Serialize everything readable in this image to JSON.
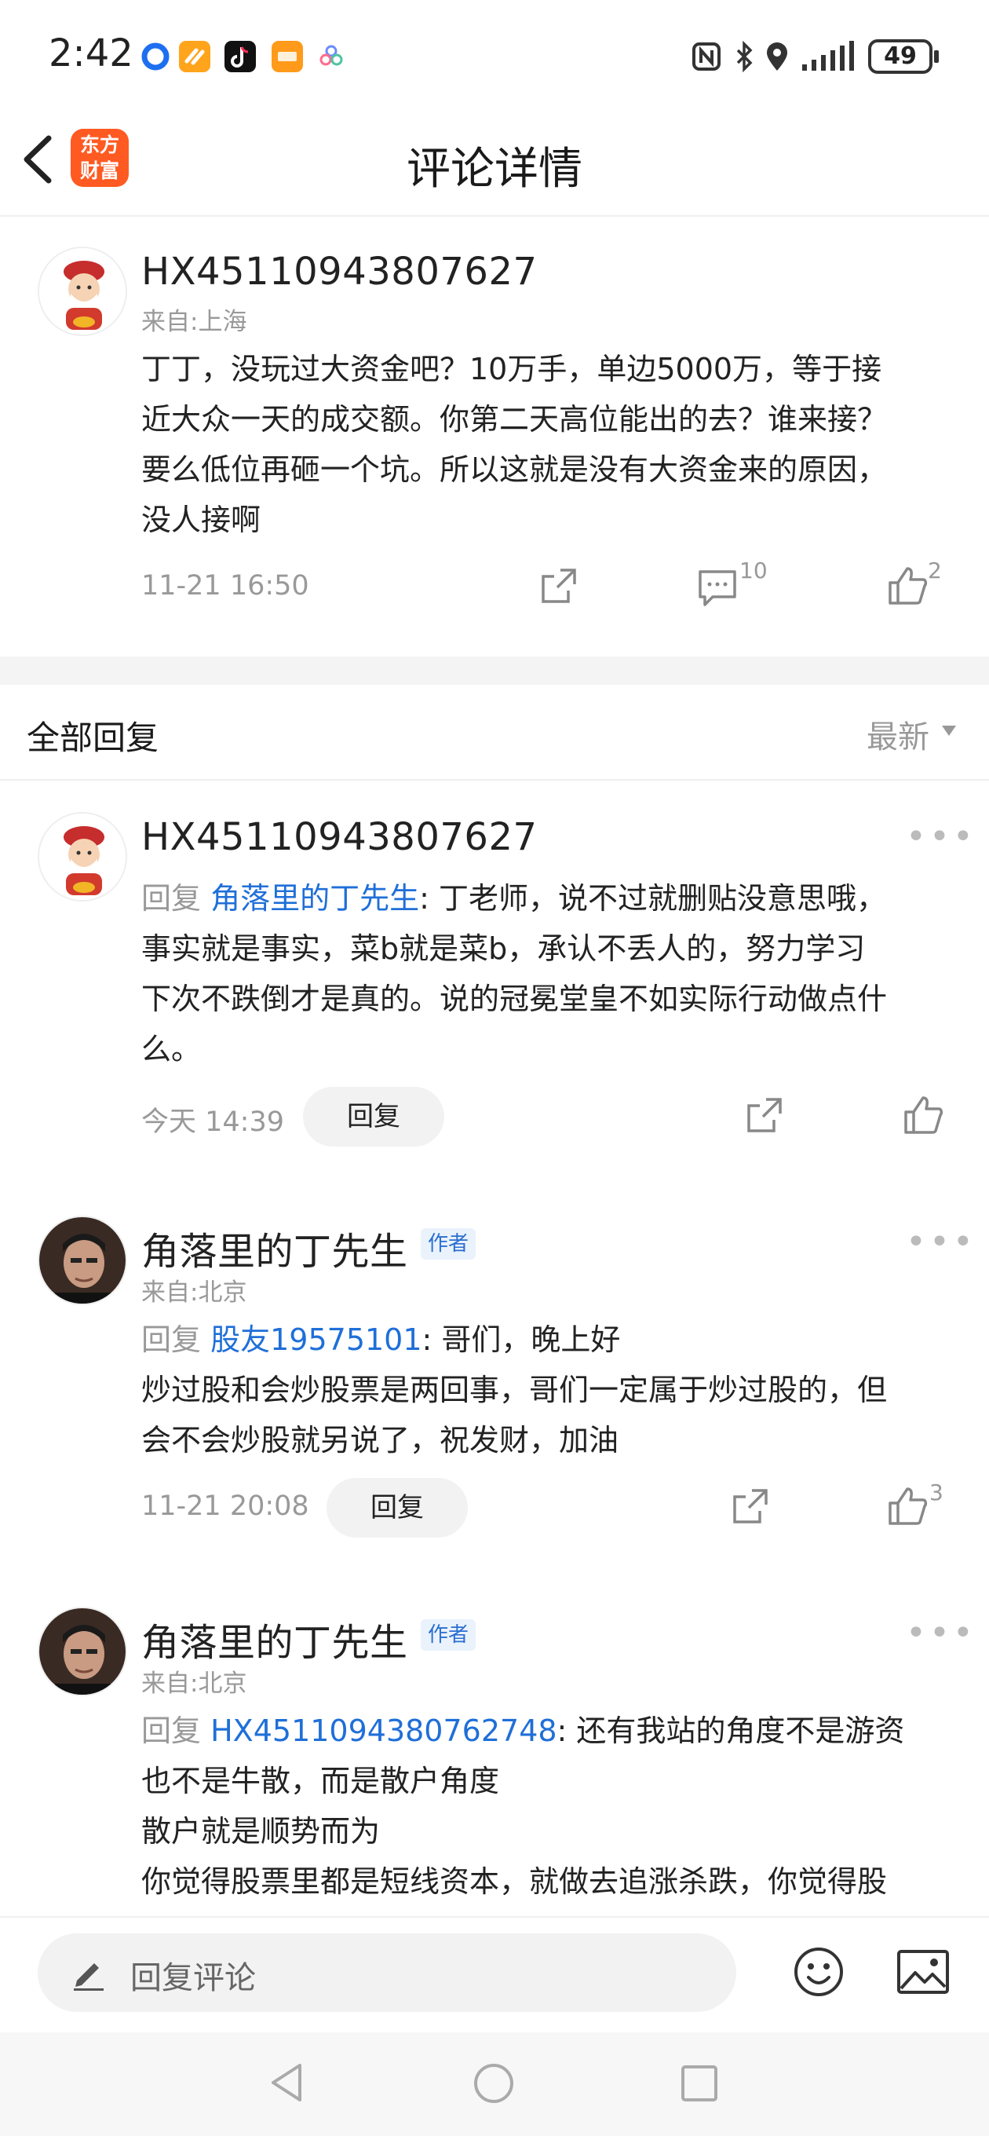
{
  "status_bar": {
    "time": "2:42",
    "battery": "49",
    "app_icons": [
      "blue-circle-app-icon",
      "orange-app-icon",
      "tiktok-app-icon",
      "orange-square-app-icon",
      "flower-app-icon"
    ],
    "system_icons": [
      "nfc-icon",
      "bluetooth-icon",
      "location-icon",
      "signal-icon",
      "battery-icon"
    ]
  },
  "header": {
    "title": "评论详情",
    "logo_line1": "东方",
    "logo_line2": "财富"
  },
  "main_post": {
    "username": "HX45110943807627",
    "location": "来自:上海",
    "lines": [
      "丁丁，没玩过大资金吧？10万手，单边5000万，等于接",
      "近大众一天的成交额。你第二天高位能出的去？谁来接？",
      "要么低位再砸一个坑。所以这就是没有大资金来的原因，",
      "没人接啊"
    ],
    "time": "11-21 16:50",
    "comment_count": "10",
    "like_count": "2"
  },
  "section": {
    "title": "全部回复",
    "sort": "最新"
  },
  "replies": [
    {
      "username": "HX45110943807627",
      "reply_prefix": "回复",
      "reply_to": "角落里的丁先生",
      "lines": [
        ": 丁老师，说不过就删贴没意思哦，",
        "事实就是事实，菜b就是菜b，承认不丢人的，努力学习",
        "下次不跌倒才是真的。说的冠冕堂皇不如实际行动做点什",
        "么。"
      ],
      "time": "今天 14:39",
      "reply_button": "回复"
    },
    {
      "username": "角落里的丁先生",
      "author_tag": "作者",
      "location": "来自:北京",
      "reply_prefix": "回复",
      "reply_to": "股友19575101",
      "lines": [
        ": 哥们，晚上好",
        "炒过股和会炒股票是两回事，哥们一定属于炒过股的，但",
        "会不会炒股就另说了，祝发财，加油"
      ],
      "time": "11-21 20:08",
      "reply_button": "回复",
      "like_count": "3"
    },
    {
      "username": "角落里的丁先生",
      "author_tag": "作者",
      "location": "来自:北京",
      "reply_prefix": "回复",
      "reply_to": "HX4511094380762748",
      "lines": [
        ": 还有我站的角度不是游资",
        "也不是牛散，而是散户角度",
        "散户就是顺势而为",
        "你觉得股票里都是短线资本，就做去追涨杀跌，你觉得股"
      ]
    }
  ],
  "bottom_bar": {
    "input_placeholder": "回复评论"
  },
  "colors": {
    "accent_blue": "#1f6fd8",
    "logo_orange": "#ff5a22",
    "muted_gray": "#999999"
  }
}
